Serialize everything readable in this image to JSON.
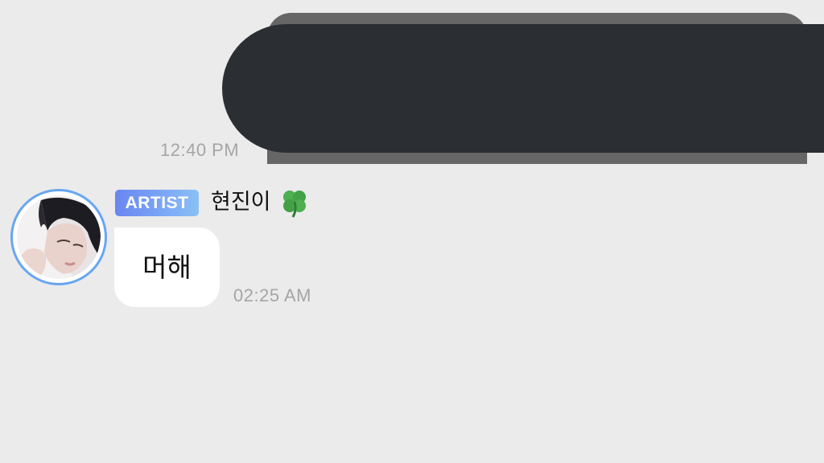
{
  "outgoing_message": {
    "time": "12:40 PM"
  },
  "incoming_message": {
    "badge": "ARTIST",
    "sender": "현진이",
    "sender_emoji_icon": "four-leaf-clover-icon",
    "text": "머해",
    "time": "02:25 AM"
  },
  "colors": {
    "background": "#ebebeb",
    "avatar_ring": "#68a6f2",
    "badge_gradient": [
      "#6a86f0",
      "#8bc0f5"
    ],
    "redacted_bubble": "#2b2f33",
    "timestamp": "#a5a5a5"
  }
}
